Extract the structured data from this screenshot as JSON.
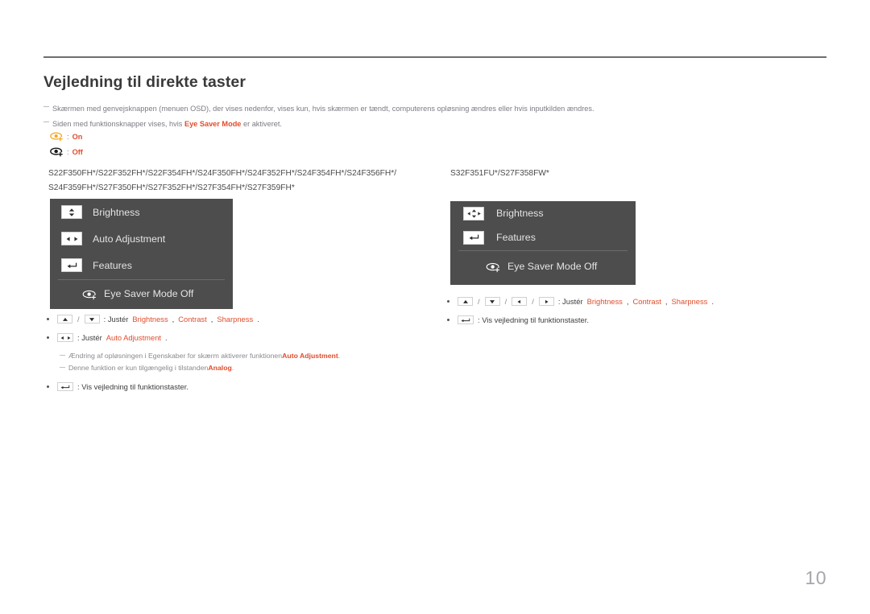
{
  "page": {
    "title": "Vejledning til direkte taster",
    "number": "10"
  },
  "notes": [
    "Skærmen med genvejsknappen (menuen OSD), der vises nedenfor, vises kun, hvis skærmen er tændt, computerens opløsning ændres eller hvis inputkilden ændres.",
    {
      "pre": "Siden med funktionsknapper vises, hvis ",
      "hl": "Eye Saver Mode",
      "post": " er aktiveret."
    }
  ],
  "eye_legend": [
    {
      "icon": "eye-saver-on-icon",
      "sep": ":",
      "label": "On",
      "color": "#f5a623"
    },
    {
      "icon": "eye-saver-off-icon",
      "sep": ":",
      "label": "Off",
      "color": "#1a1a1a"
    }
  ],
  "left_column": {
    "models_line1": "S22F350FH*/S22F352FH*/S22F354FH*/S24F350FH*/S24F352FH*/S24F354FH*/S24F356FH*/",
    "models_line2": "S24F359FH*/S27F350FH*/S27F352FH*/S27F354FH*/S27F359FH*",
    "osd": {
      "rows": [
        {
          "icon": "up-down-key-icon",
          "label": "Brightness"
        },
        {
          "icon": "left-right-key-icon",
          "label": "Auto Adjustment"
        },
        {
          "icon": "enter-key-icon",
          "label": "Features"
        }
      ],
      "eye_row": {
        "icon": "eye-saver-icon",
        "label": "Eye Saver Mode Off"
      }
    },
    "bullets": [
      {
        "keys": [
          "up-key-icon",
          "down-key-icon"
        ],
        "text_pre": ": Justér ",
        "highlights": [
          "Brightness",
          "Contrast",
          "Sharpness"
        ],
        "text_post": "."
      },
      {
        "keys": [
          "left-right-key-icon"
        ],
        "text_pre": ": Justér ",
        "highlights": [
          "Auto Adjustment"
        ],
        "text_post": "."
      }
    ],
    "sub_notes": [
      {
        "pre": "Ændring af opløsningen i Egenskaber for skærm aktiverer funktionen ",
        "hl": "Auto Adjustment",
        "post": "."
      },
      {
        "pre": "Denne funktion er kun tilgængelig i tilstanden ",
        "hl": "Analog",
        "post": "."
      }
    ],
    "last_bullet": {
      "keys": [
        "enter-key-icon"
      ],
      "text": ": Vis vejledning til funktionstaster."
    }
  },
  "right_column": {
    "models_line1": "S32F351FU*/S27F358FW*",
    "osd": {
      "rows": [
        {
          "icon": "four-way-key-icon",
          "label": "Brightness"
        },
        {
          "icon": "enter-key-icon",
          "label": "Features"
        }
      ],
      "eye_row": {
        "icon": "eye-saver-icon",
        "label": "Eye Saver Mode Off"
      }
    },
    "bullets": [
      {
        "keys": [
          "up-key-icon",
          "down-key-icon",
          "left-key-icon",
          "right-key-icon"
        ],
        "text_pre": ": Justér ",
        "highlights": [
          "Brightness",
          "Contrast",
          "Sharpness"
        ],
        "text_post": "."
      },
      {
        "keys": [
          "enter-key-icon"
        ],
        "text_pre": ": Vis vejledning til funktionstaster.",
        "highlights": [],
        "text_post": ""
      }
    ]
  },
  "colors": {
    "accent": "#e04d2d",
    "osd_bg": "#4d4d4d",
    "rule": "#6e6e6e",
    "note_text": "#7b7b84",
    "page_number": "#a6a6ad",
    "eye_on": "#f5a623"
  }
}
